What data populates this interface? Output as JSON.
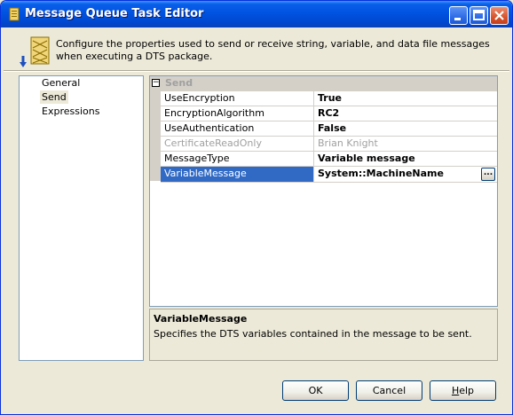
{
  "window": {
    "title": "Message Queue Task Editor",
    "icon": "task-editor-icon"
  },
  "header": {
    "icon": "message-queue-icon",
    "description": "Configure the properties used to send or receive string, variable, and data file messages when executing a DTS package."
  },
  "nav": {
    "items": [
      {
        "label": "General",
        "selected": false
      },
      {
        "label": "Send",
        "selected": true
      },
      {
        "label": "Expressions",
        "selected": false
      }
    ]
  },
  "grid": {
    "category": "Send",
    "category_toggle": "⊟",
    "rows": [
      {
        "name": "UseEncryption",
        "value": "True",
        "state": "normal"
      },
      {
        "name": "EncryptionAlgorithm",
        "value": "RC2",
        "state": "normal"
      },
      {
        "name": "UseAuthentication",
        "value": "False",
        "state": "normal"
      },
      {
        "name": "CertificateReadOnly",
        "value": "Brian Knight",
        "state": "disabled"
      },
      {
        "name": "MessageType",
        "value": "Variable message",
        "state": "normal"
      },
      {
        "name": "VariableMessage",
        "value": "System::MachineName",
        "state": "selected"
      }
    ],
    "ellipsis_label": "..."
  },
  "description": {
    "title": "VariableMessage",
    "text": "Specifies the DTS variables contained in the message to be sent."
  },
  "buttons": {
    "ok": "OK",
    "cancel": "Cancel",
    "help_mnemonic": "H",
    "help_rest": "elp"
  },
  "colors": {
    "titlebar": "#0053e1",
    "selection": "#316ac5",
    "dialog_bg": "#ece9d8"
  }
}
